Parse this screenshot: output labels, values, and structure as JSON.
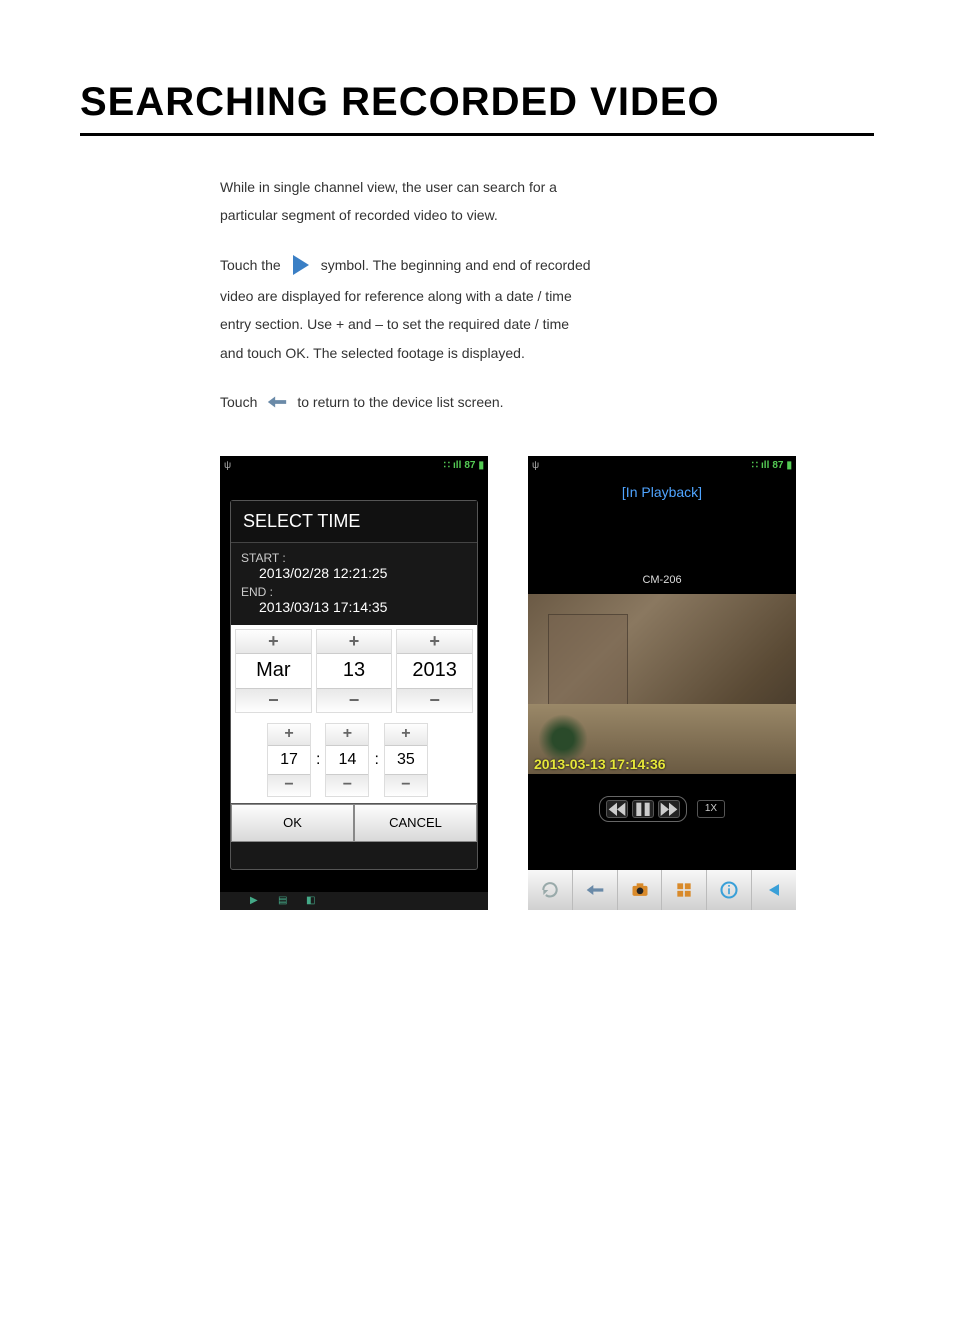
{
  "page": {
    "title": "SEARCHING RECORDED VIDEO"
  },
  "instructions": {
    "line1": "While in single channel view, the user can search for a",
    "line2": "particular segment of recorded video to view.",
    "line3_pre": "Touch the ",
    "line3_post": " symbol. The beginning and end of recorded",
    "line4": "video are displayed for reference along with a date / time",
    "line5": "entry section. Use + and – to set the required date / time",
    "line6": "and touch OK. The selected footage is displayed.",
    "line7_pre": "Touch ",
    "line7_post": " to return to the device list screen."
  },
  "phone_left": {
    "status": {
      "signal": "ıll",
      "level": "87"
    },
    "dialog_title": "SELECT TIME",
    "start_label": "START :",
    "start_value": "2013/02/28 12:21:25",
    "end_label": "END :",
    "end_value": "2013/03/13 17:14:35",
    "date": {
      "month": "Mar",
      "day": "13",
      "year": "2013"
    },
    "time": {
      "h": "17",
      "m": "14",
      "s": "35"
    },
    "ok": "OK",
    "cancel": "CANCEL"
  },
  "phone_right": {
    "status": {
      "signal": "ıll",
      "level": "87"
    },
    "header": "[In Playback]",
    "camera": "CM-206",
    "timestamp": "2013-03-13 17:14:36",
    "speed": "1X"
  }
}
